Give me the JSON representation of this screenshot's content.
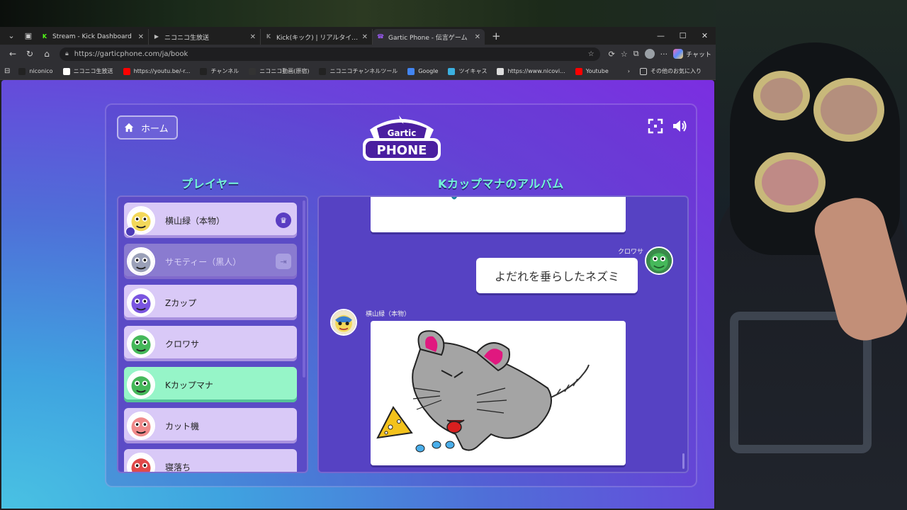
{
  "browser": {
    "tabs": [
      {
        "title": "Stream - Kick Dashboard",
        "color": "#53fc18",
        "glyph": "K"
      },
      {
        "title": "ニコニコ生放送",
        "color": "#bbbbbb",
        "glyph": "▶"
      },
      {
        "title": "Kick(キック) | リアルタイムランキング",
        "color": "#888888",
        "glyph": "K"
      },
      {
        "title": "Gartic Phone - 伝言ゲーム",
        "color": "#9b59f5",
        "glyph": "☎"
      }
    ],
    "url": "https://garticphone.com/ja/book",
    "copilot_label": "チャット",
    "bookmarks": [
      {
        "label": "niconico",
        "color": "#222222"
      },
      {
        "label": "ニコニコ生放送",
        "color": "#ffffff"
      },
      {
        "label": "https://youtu.be/-r...",
        "color": "#ff0000"
      },
      {
        "label": "チャンネル",
        "color": "#222222"
      },
      {
        "label": "ニコニコ動画(原宿)",
        "color": "#333333"
      },
      {
        "label": "ニコニコチャンネルツール",
        "color": "#222222"
      },
      {
        "label": "Google",
        "color": "#4285f4"
      },
      {
        "label": "ツイキャス",
        "color": "#3bb0e0"
      },
      {
        "label": "https://www.nicovi...",
        "color": "#dddddd"
      },
      {
        "label": "Youtube",
        "color": "#ff0000"
      }
    ],
    "other_bookmarks": "その他のお気に入り"
  },
  "game": {
    "home_label": "ホーム",
    "logo_top": "Gartic",
    "logo_bottom": "PHONE",
    "players_title": "プレイヤー",
    "album_title": "Kカップマナのアルバム",
    "players": [
      {
        "name": "横山緑（本物）",
        "state": "owner",
        "avatar_color": "#f3d85a",
        "badge": "♛"
      },
      {
        "name": "サモティー（黒人）",
        "state": "left",
        "avatar_color": "#9aa0b8",
        "badge": "⇥"
      },
      {
        "name": "Zカップ",
        "state": "normal",
        "avatar_color": "#7a55e0"
      },
      {
        "name": "クロワサ",
        "state": "normal",
        "avatar_color": "#45b85a"
      },
      {
        "name": "Kカップマナ",
        "state": "highlight",
        "avatar_color": "#45b85a"
      },
      {
        "name": "カット機",
        "state": "normal",
        "avatar_color": "#f08a8a"
      },
      {
        "name": "寝落ち",
        "state": "normal",
        "avatar_color": "#e04a4a"
      }
    ],
    "album": {
      "guess_author": "クロワサ",
      "guess_text": "よだれを垂らしたネズミ",
      "drawing_author": "横山緑（本物）"
    }
  },
  "colors": {
    "accent": "#74f5d8",
    "highlight_row": "#96f5c8"
  }
}
